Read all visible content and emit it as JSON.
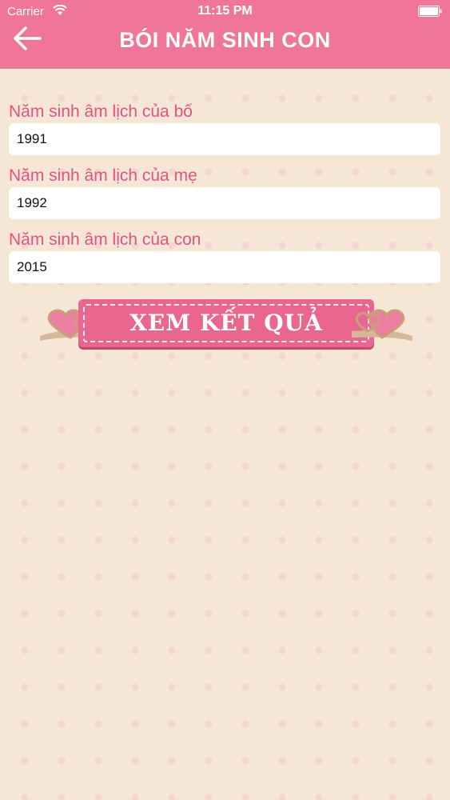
{
  "status_bar": {
    "carrier": "Carrier",
    "time": "11:15 PM"
  },
  "header": {
    "title": "BÓI NĂM SINH CON",
    "back_icon": "arrow-left-icon"
  },
  "form": {
    "father": {
      "label": "Năm sinh âm lịch của bố",
      "value": "1991"
    },
    "mother": {
      "label": "Năm sinh âm lịch của mẹ",
      "value": "1992"
    },
    "child": {
      "label": "Năm sinh âm lịch của con",
      "value": "2015"
    }
  },
  "result_button": {
    "label": "XEM KẾT QUẢ"
  },
  "colors": {
    "header_pink": "#ef7699",
    "label_pink": "#e0557f",
    "background": "#f5e6d6",
    "button_pink": "#e9668f"
  }
}
